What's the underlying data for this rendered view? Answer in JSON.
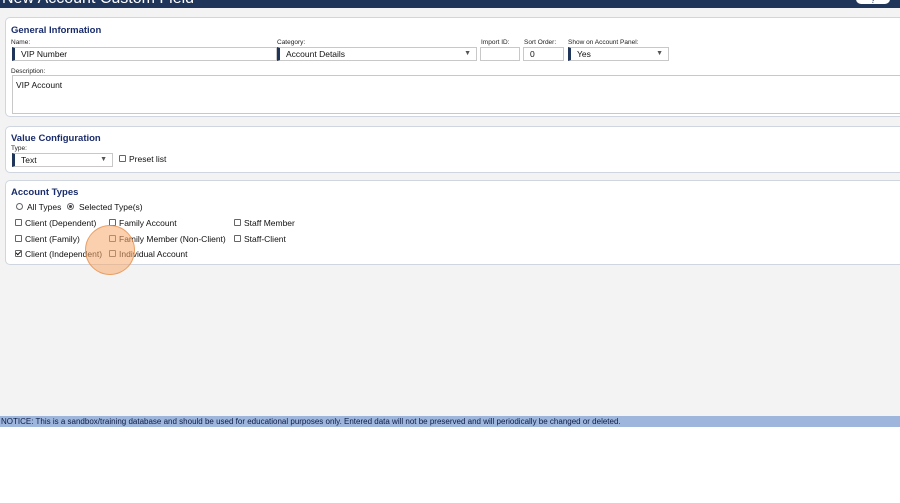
{
  "window": {
    "title": "New Account Custom Field",
    "help_label": "?"
  },
  "general": {
    "heading": "General Information",
    "name_label": "Name:",
    "name_value": "VIP Number",
    "category_label": "Category:",
    "category_value": "Account Details",
    "import_id_label": "Import ID:",
    "import_id_value": "",
    "sort_order_label": "Sort Order:",
    "sort_order_value": "0",
    "show_panel_label": "Show on Account Panel:",
    "show_panel_value": "Yes",
    "description_label": "Description:",
    "description_value": "VIP Account"
  },
  "value_config": {
    "heading": "Value Configuration",
    "type_label": "Type:",
    "type_value": "Text",
    "preset_list_label": "Preset list",
    "preset_list_checked": false
  },
  "account_types": {
    "heading": "Account Types",
    "radio_all_label": "All Types",
    "radio_selected_label": "Selected Type(s)",
    "selected_mode": "Selected Type(s)",
    "options": [
      {
        "label": "Client (Dependent)",
        "checked": false
      },
      {
        "label": "Family Account",
        "checked": false
      },
      {
        "label": "Staff Member",
        "checked": false
      },
      {
        "label": "Client (Family)",
        "checked": false
      },
      {
        "label": "Family Member (Non-Client)",
        "checked": false
      },
      {
        "label": "Staff-Client",
        "checked": false
      },
      {
        "label": "Client (Independent)",
        "checked": true
      },
      {
        "label": "Individual Account",
        "checked": false
      }
    ]
  },
  "notice": {
    "text": "NOTICE: This is a sandbox/training database and should be used for educational purposes only. Entered data will not be preserved and will periodically be changed or deleted."
  },
  "colors": {
    "header_bg": "#1f3559",
    "heading_text": "#1a2c6b",
    "notice_bg": "#9fb6dc",
    "click_indicator": "#f5aa6e"
  }
}
